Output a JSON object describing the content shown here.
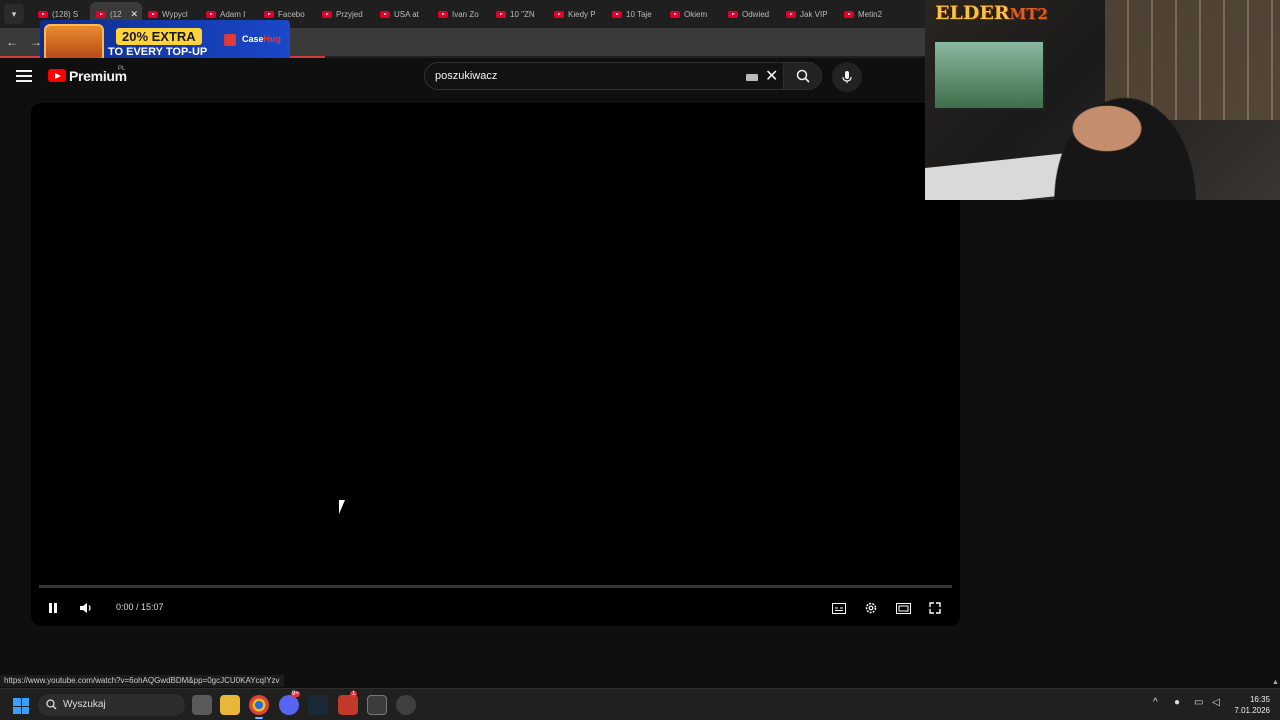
{
  "browser": {
    "tabs": [
      {
        "label": "(128) S",
        "active": false
      },
      {
        "label": "(12",
        "active": true
      },
      {
        "label": "Wypycl",
        "active": false
      },
      {
        "label": "Adam I",
        "active": false
      },
      {
        "label": "Facebo",
        "active": false
      },
      {
        "label": "Przyjed",
        "active": false
      },
      {
        "label": "USA at",
        "active": false
      },
      {
        "label": "Ivan Zo",
        "active": false
      },
      {
        "label": "10 \"ZN",
        "active": false
      },
      {
        "label": "Kiedy P",
        "active": false
      },
      {
        "label": "10 Taje",
        "active": false
      },
      {
        "label": "Okiem",
        "active": false
      },
      {
        "label": "Odwied",
        "active": false
      },
      {
        "label": "Jak VIP",
        "active": false
      },
      {
        "label": "Metin2",
        "active": false
      }
    ],
    "status_url": "https://www.youtube.com/watch?v=6ohAQGwdBDM&pp=0gcJCU0KAYcqIYzv"
  },
  "ad": {
    "line1": "20% EXTRA",
    "line2": "TO EVERY TOP-UP",
    "brand_a": "Case",
    "brand_b": "Hug"
  },
  "youtube": {
    "logo_text": "Premium",
    "country": "PL",
    "search_value": "poszukiwacz"
  },
  "player": {
    "time": "0:00 / 15:07",
    "progress_fraction": 0.0
  },
  "webcam": {
    "overlay_text": "ELDER"
  },
  "taskbar": {
    "search_label": "Wyszukaj",
    "time": "16:35",
    "date": "7.01.2026",
    "discord_badge": "9+",
    "game_badge": "1"
  },
  "colors": {
    "accent_red": "#ff0000",
    "page_bg": "#0f0f0f"
  }
}
